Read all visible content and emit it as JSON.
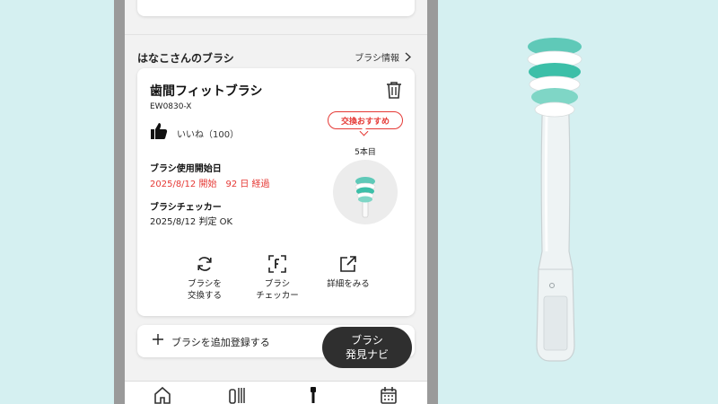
{
  "section": {
    "title": "はなこさんのブラシ",
    "info_link": "ブラシ情報"
  },
  "brush": {
    "name": "歯間フィットブラシ",
    "model": "EW0830-X",
    "likes_label": "いいね（100）",
    "replace_badge": "交換おすすめ",
    "count_label": "5本目",
    "start_date_label": "ブラシ使用開始日",
    "start_date_value": "2025/8/12 開始　92 日 経過",
    "checker_label": "ブラシチェッカー",
    "checker_value": "2025/8/12 判定 OK"
  },
  "actions": [
    {
      "label": "ブラシを\n交換する",
      "icon": "refresh-icon"
    },
    {
      "label": "ブラシ\nチェッカー",
      "icon": "scan-icon"
    },
    {
      "label": "詳細をみる",
      "icon": "external-link-icon"
    }
  ],
  "add_brush": {
    "label": "ブラシを追加登録する"
  },
  "finder_button": {
    "line1": "ブラシ",
    "line2": "発見ナビ"
  },
  "nav": [
    {
      "icon": "home-icon"
    },
    {
      "icon": "tools-icon"
    },
    {
      "icon": "toothbrush-icon",
      "active": true
    },
    {
      "icon": "calendar-icon"
    }
  ],
  "colors": {
    "background": "#d5f0f1",
    "accent_red": "#e53935",
    "bristle_teal": "#3cbfa8",
    "dark_button": "#2f2f2f"
  }
}
